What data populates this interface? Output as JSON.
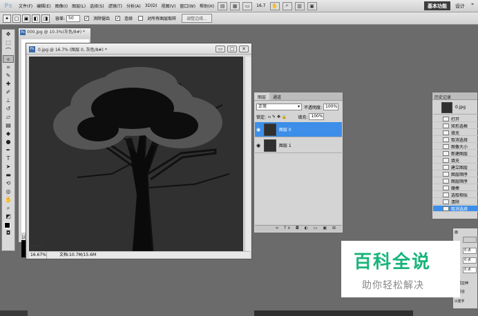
{
  "menubar": {
    "logo": "Ps",
    "items": [
      "文件(F)",
      "编辑(E)",
      "图像(I)",
      "图层(L)",
      "选择(S)",
      "滤镜(T)",
      "分析(A)",
      "3D(D)",
      "视图(V)",
      "窗口(W)",
      "帮助(H)"
    ],
    "zoom": "16.7",
    "workspace_active": "基本功能",
    "workspace_other": "设计",
    "workspace_more": "»"
  },
  "optbar": {
    "tolerance_label": "容差:",
    "tolerance_value": "50",
    "antialias_label": "消除锯齿",
    "contiguous_label": "连续",
    "all_layers_label": "对所有图层取样",
    "refine_button": "调整边缘..."
  },
  "doc_back": {
    "title": "000.jpg @ 10.3%(灰色/8#) *",
    "status": "10.3"
  },
  "doc_main": {
    "title": "0.jpg @ 16.7% (图层 0, 灰色/8#) *",
    "zoom_status": "16.67%",
    "doc_info": "文档:10.7M/15.6M"
  },
  "layers_panel": {
    "tab_layers": "图层",
    "tab_channels": "通道",
    "blend_mode": "正常",
    "opacity_label": "不透明度:",
    "opacity_value": "100%",
    "lock_label": "锁定:",
    "fill_label": "填充:",
    "fill_value": "100%",
    "layers": [
      {
        "name": "图层 0",
        "selected": true
      },
      {
        "name": "图层 1",
        "selected": false
      }
    ],
    "bottom_icons": "∞ fx ◘ ◐ ▭ ▣ ⊞"
  },
  "history_panel": {
    "tab": "历史记录",
    "snapshot": "0.jpg",
    "items": [
      "打开",
      "矩形选框",
      "填充",
      "取消选择",
      "图像大小",
      "新建图层",
      "填充",
      "建立图层",
      "图层顺序",
      "图层顺序",
      "魔棒",
      "选取相似",
      "清除",
      "取消选择"
    ],
    "selected_index": 13
  },
  "right_panel": {
    "label_top": "画",
    "field1": "0 点",
    "field2": "0 点",
    "field3": "0 点",
    "text1": "头尾拉伸",
    "text2": "画组合",
    "text3": "☑连字"
  },
  "watermark": {
    "big": "百科全说",
    "small": "助你轻松解决",
    "big_color": "#18b47a"
  }
}
